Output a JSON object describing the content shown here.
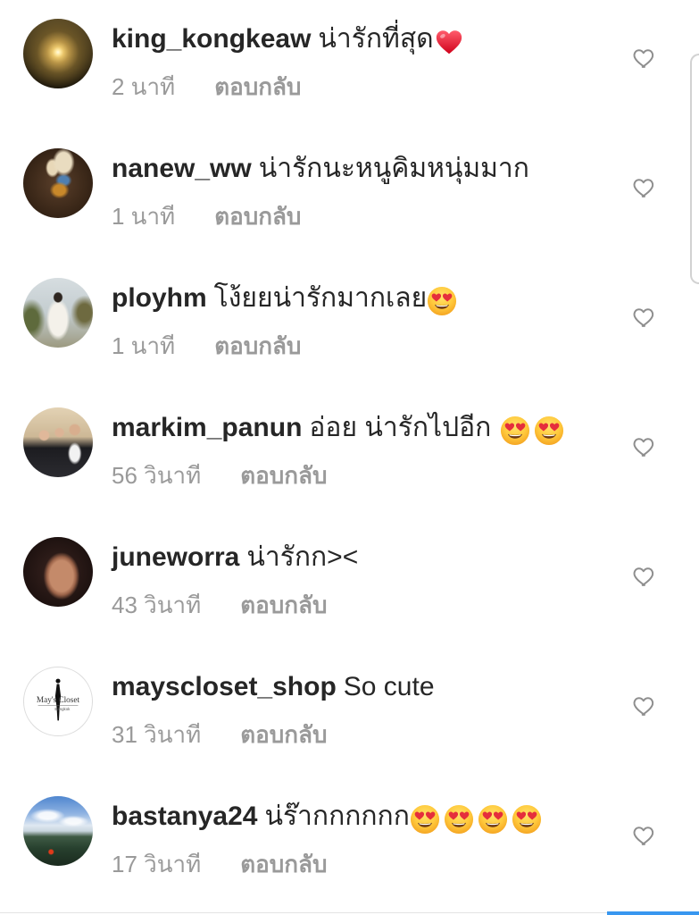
{
  "comments": [
    {
      "username": "king_kongkeaw",
      "text": "น่ารักที่สุด",
      "emojis": [
        "red-heart-emoji"
      ],
      "time": "2 นาที",
      "reply_label": "ตอบกลับ"
    },
    {
      "username": "nanew_ww",
      "text": "น่ารักนะหนูคิมหนุ่มมาก",
      "time": "1 นาที",
      "reply_label": "ตอบกลับ"
    },
    {
      "username": "ployhm",
      "text": "โง้ยยน่ารักมากเลย",
      "emojis": [
        "heart-eyes-emoji"
      ],
      "time": "1 นาที",
      "reply_label": "ตอบกลับ"
    },
    {
      "username": "markim_panun",
      "text": "อ่อย น่ารักไปอีก",
      "emojis": [
        "heart-eyes-emoji",
        "heart-eyes-emoji"
      ],
      "time": "56 วินาที",
      "reply_label": "ตอบกลับ"
    },
    {
      "username": "juneworra",
      "text": "น่ารักก><",
      "time": "43 วินาที",
      "reply_label": "ตอบกลับ"
    },
    {
      "username": "mayscloset_shop",
      "text": "So cute",
      "time": "31 วินาที",
      "reply_label": "ตอบกลับ",
      "avatar_logo": {
        "title": "May's Closet",
        "subtitle": "Bangkok"
      }
    },
    {
      "username": "bastanya24",
      "text": "น่ร๊ากกกกกก",
      "emojis": [
        "heart-eyes-emoji",
        "heart-eyes-emoji",
        "heart-eyes-emoji",
        "heart-eyes-emoji"
      ],
      "time": "17 วินาที",
      "reply_label": "ตอบกลับ"
    }
  ],
  "icons": {
    "like": "heart-outline-icon"
  },
  "colors": {
    "text": "#262626",
    "secondary": "#9a9a9a",
    "icon": "#8e8e8e",
    "accent": "#3897f0"
  }
}
